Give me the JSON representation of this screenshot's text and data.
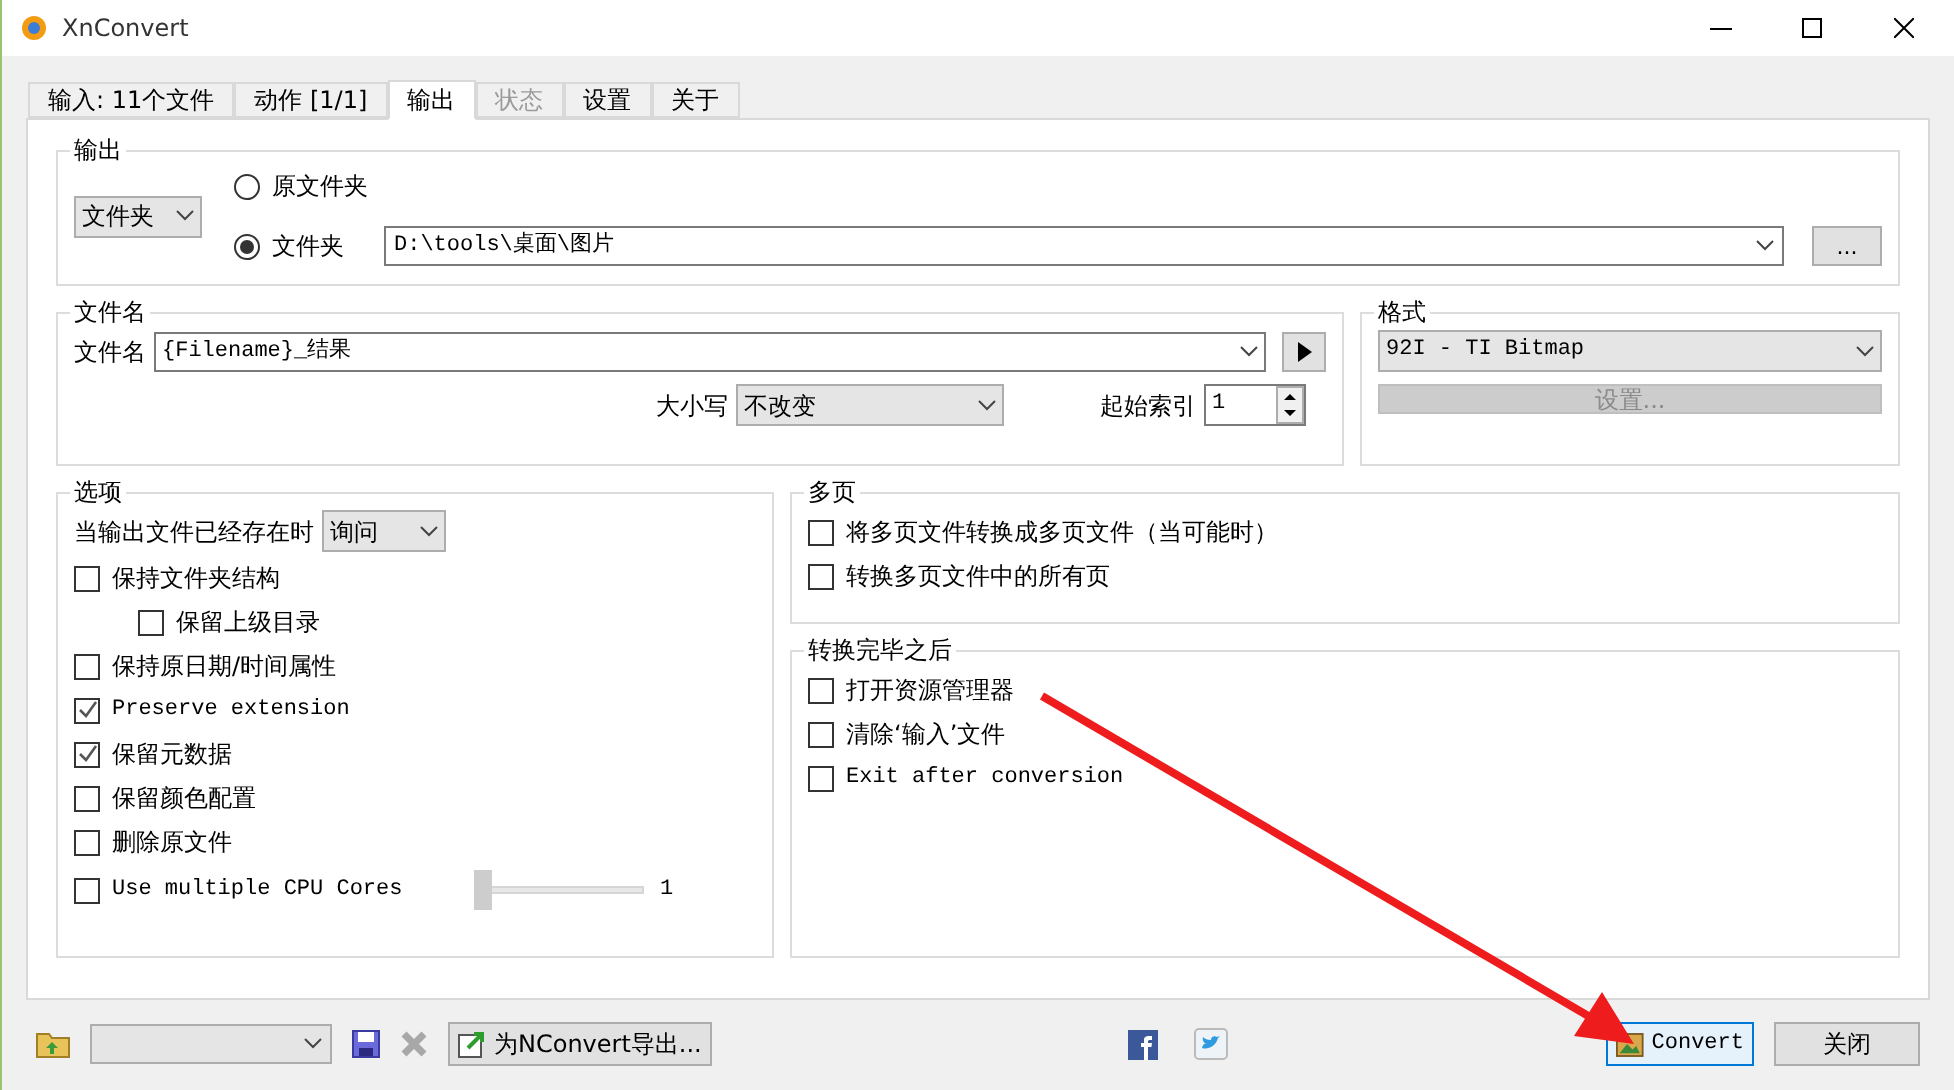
{
  "window": {
    "title": "XnConvert"
  },
  "tabs": [
    {
      "label": "输入: 11个文件",
      "selected": false,
      "disabled": false
    },
    {
      "label": "动作 [1/1]",
      "selected": false,
      "disabled": false
    },
    {
      "label": "输出",
      "selected": true,
      "disabled": false
    },
    {
      "label": "状态",
      "selected": false,
      "disabled": true
    },
    {
      "label": "设置",
      "selected": false,
      "disabled": false
    },
    {
      "label": "关于",
      "selected": false,
      "disabled": false
    }
  ],
  "output": {
    "title": "输出",
    "mode_select": "文件夹",
    "radios": [
      {
        "label": "原文件夹",
        "selected": false
      },
      {
        "label": "文件夹",
        "selected": true
      }
    ],
    "folder_path": "D:\\tools\\桌面\\图片",
    "browse_button": "..."
  },
  "filename": {
    "title": "文件名",
    "label": "文件名",
    "value": "{Filename}_结果",
    "case_label": "大小写",
    "case_value": "不改变",
    "start_index_label": "起始索引",
    "start_index_value": "1"
  },
  "format": {
    "title": "格式",
    "value": "92I - TI Bitmap",
    "settings_button": "设置...",
    "settings_disabled": true
  },
  "options": {
    "title": "选项",
    "exists_label": "当输出文件已经存在时",
    "exists_value": "询问",
    "items": [
      {
        "kind": "checkbox",
        "label": "保持文件夹结构",
        "checked": false,
        "mono": false,
        "children": [
          {
            "label": "保留上级目录",
            "checked": false,
            "mono": false
          }
        ]
      },
      {
        "kind": "checkbox",
        "label": "保持原日期/时间属性",
        "checked": false,
        "mono": false
      },
      {
        "kind": "checkbox",
        "label": "Preserve extension",
        "checked": true,
        "mono": true
      },
      {
        "kind": "checkbox",
        "label": "保留元数据",
        "checked": true,
        "mono": false
      },
      {
        "kind": "checkbox",
        "label": "保留颜色配置",
        "checked": false,
        "mono": false
      },
      {
        "kind": "checkbox",
        "label": "删除原文件",
        "checked": false,
        "mono": false
      },
      {
        "kind": "slider",
        "label": "Use multiple CPU Cores",
        "checked": false,
        "mono": true,
        "level": 0,
        "reading": "1"
      }
    ]
  },
  "multipage": {
    "title": "多页",
    "items": [
      {
        "label": "将多页文件转换成多页文件（当可能时）",
        "checked": false,
        "mono": false
      },
      {
        "label": "转换多页文件中的所有页",
        "checked": false,
        "mono": false
      }
    ]
  },
  "after_conversion": {
    "title": "转换完毕之后",
    "items": [
      {
        "label": "打开资源管理器",
        "checked": false,
        "mono": false
      },
      {
        "label": "清除‘输入’文件",
        "checked": false,
        "mono": false
      },
      {
        "label": "Exit after conversion",
        "checked": false,
        "mono": true
      }
    ]
  },
  "bottom_bar": {
    "export_button": "为NConvert导出...",
    "convert_button": "Convert",
    "close_button": "关闭"
  }
}
